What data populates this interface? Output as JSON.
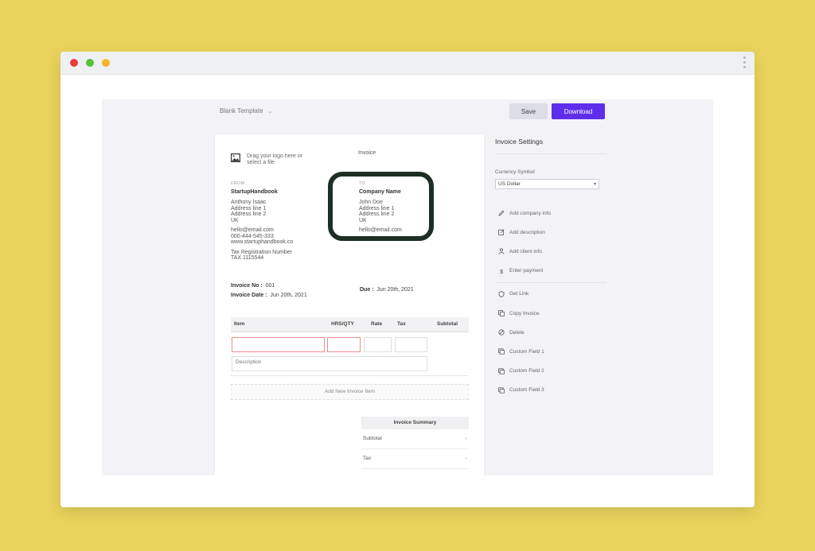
{
  "window": {
    "dots": [
      "close",
      "minimize",
      "maximize"
    ]
  },
  "toolbar": {
    "template_label": "Blank Template",
    "save_label": "Save",
    "download_label": "Download"
  },
  "colors": {
    "accent": "#5f2eea",
    "background": "#e9d35c",
    "highlight": "#1e2e24"
  },
  "invoice": {
    "logo_prompt": "Drag your logo here or select a file",
    "title": "Invoice",
    "from": {
      "label": "FROM",
      "company": "StartupHandbook",
      "name": "Anthony Isaac",
      "address1": "Address line 1",
      "address2": "Address line 2",
      "country": "UK",
      "email": "hello@email.com",
      "phone": "000-444-545-333",
      "website": "www.startuphandbook.co",
      "tax_label": "Tax Registration Number",
      "tax_value": "TAX 1115544"
    },
    "to": {
      "label": "TO",
      "company": "Company Name",
      "name": "John Doe",
      "address1": "Address line 1",
      "address2": "Address line 2",
      "country": "UK",
      "email": "hello@email.com"
    },
    "number_label": "Invoice No :",
    "number": "001",
    "date_label": "Invoice Date :",
    "date": "Jun 20th, 2021",
    "due_label": "Due :",
    "due": "Jun 20th, 2021",
    "columns": [
      "Item",
      "HRS/QTY",
      "Rate",
      "Tax",
      "Subtotal"
    ],
    "description_placeholder": "Description",
    "add_item": "Add New Invoice Item",
    "summary": {
      "header": "Invoice Summary",
      "rows": [
        {
          "label": "Subtotal",
          "value": "-"
        },
        {
          "label": "Tax",
          "value": "-"
        }
      ]
    }
  },
  "settings": {
    "title": "Invoice Settings",
    "currency_label": "Currency Symbol",
    "currency_value": "US Dollar",
    "group1": [
      {
        "label": "Add company info",
        "icon": "pencil-icon"
      },
      {
        "label": "Add description",
        "icon": "edit-box-icon"
      },
      {
        "label": "Add client info",
        "icon": "user-icon"
      },
      {
        "label": "Enter payment",
        "icon": "dollar-icon"
      }
    ],
    "group2": [
      {
        "label": "Get Link",
        "icon": "shield-icon"
      },
      {
        "label": "Copy Invoice",
        "icon": "copy-icon"
      },
      {
        "label": "Delete",
        "icon": "ban-icon"
      },
      {
        "label": "Custom Field 1",
        "icon": "field-icon"
      },
      {
        "label": "Custom Field 2",
        "icon": "field-icon"
      },
      {
        "label": "Custom Field 3",
        "icon": "field-icon"
      }
    ]
  }
}
